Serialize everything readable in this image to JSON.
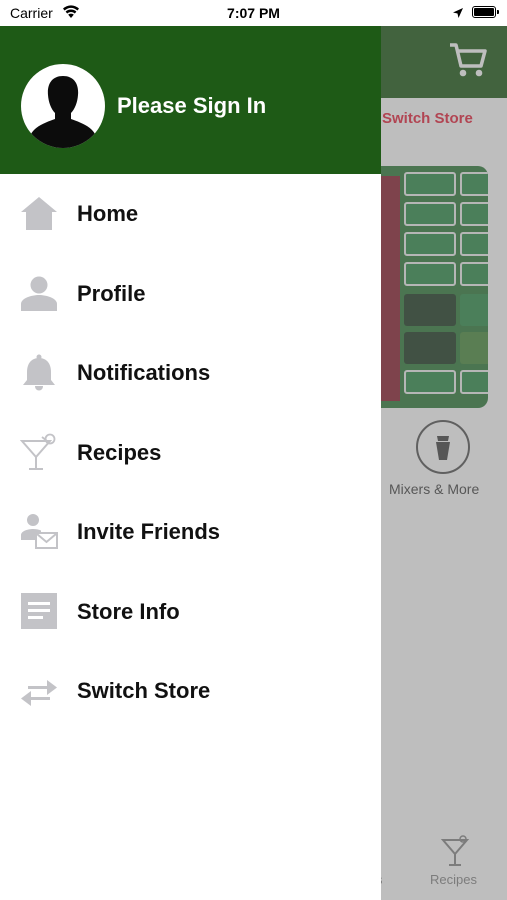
{
  "status_bar": {
    "carrier": "Carrier",
    "time": "7:07 PM"
  },
  "drawer": {
    "header_bg": "#1e5a16",
    "sign_in_label": "Please Sign In",
    "items": [
      {
        "label": "Home",
        "icon": "home-icon"
      },
      {
        "label": "Profile",
        "icon": "profile-icon"
      },
      {
        "label": "Notifications",
        "icon": "bell-icon"
      },
      {
        "label": "Recipes",
        "icon": "cocktail-icon"
      },
      {
        "label": "Invite Friends",
        "icon": "invite-friends-icon"
      },
      {
        "label": "Store Info",
        "icon": "document-icon"
      },
      {
        "label": "Switch Store",
        "icon": "switch-arrows-icon"
      }
    ]
  },
  "background_app": {
    "switch_store_label": "Switch Store",
    "category_label": "Mixers & More",
    "tab_recipes_label": "Recipes",
    "tab_partial_label": "s",
    "accent_red": "#e8243c"
  }
}
